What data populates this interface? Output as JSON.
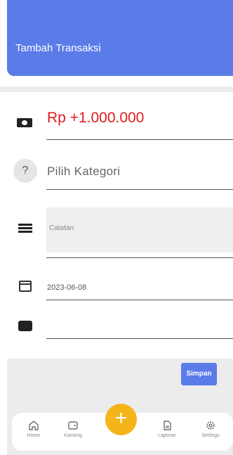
{
  "header": {
    "title": "Tambah Transaksi"
  },
  "form": {
    "amount": "Rp +1.000.000",
    "category_icon": "?",
    "category_placeholder": "Pilih Kategori",
    "notes_placeholder": "Catatan",
    "date": "2023-06-08",
    "wallet": ""
  },
  "actions": {
    "save_label": "Simpan"
  },
  "nav": {
    "items": [
      {
        "label": "Home",
        "icon": "home-icon"
      },
      {
        "label": "Kantong",
        "icon": "wallet-icon"
      },
      {
        "label": "Laporan",
        "icon": "report-icon"
      },
      {
        "label": "Settings",
        "icon": "gear-icon"
      }
    ],
    "fab_symbol": "+"
  },
  "colors": {
    "accent": "#5b7be9",
    "amount": "#e21b1b",
    "fab": "#f5b41a"
  }
}
